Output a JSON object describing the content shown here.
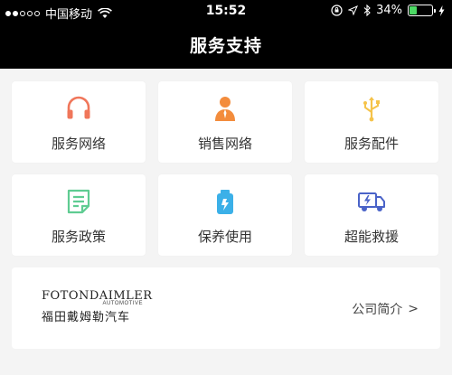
{
  "status_bar": {
    "carrier": "中国移动",
    "time": "15:52",
    "battery_percent": "34%",
    "battery_level": 0.34,
    "icons": [
      "wifi-icon",
      "lock-rotation-icon",
      "location-icon",
      "bluetooth-icon",
      "charging-icon"
    ]
  },
  "header": {
    "title": "服务支持"
  },
  "grid": {
    "items": [
      {
        "label": "服务网络",
        "icon": "headphones-icon",
        "color": "#f0765a"
      },
      {
        "label": "销售网络",
        "icon": "salesperson-icon",
        "color": "#f38c3c"
      },
      {
        "label": "服务配件",
        "icon": "usb-icon",
        "color": "#f5c34a"
      },
      {
        "label": "服务政策",
        "icon": "document-icon",
        "color": "#5fcc92"
      },
      {
        "label": "保养使用",
        "icon": "fuel-can-icon",
        "color": "#3bb0e8"
      },
      {
        "label": "超能救援",
        "icon": "rescue-truck-icon",
        "color": "#4a63c8"
      }
    ]
  },
  "company": {
    "logo_text": "FOTONDAIMLER",
    "logo_sub": "AUTOMOTIVE",
    "logo_cn": "福田戴姆勒汽车",
    "link_label": "公司简介",
    "link_arrow": ">"
  }
}
